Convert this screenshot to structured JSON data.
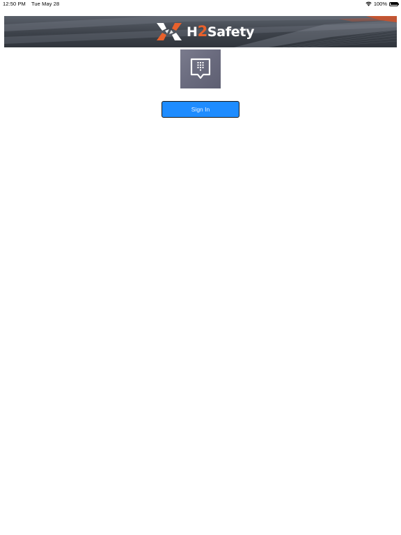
{
  "status_bar": {
    "time": "12:50 PM",
    "date": "Tue May 28",
    "battery_text": "100%",
    "battery_level": 1.0
  },
  "banner": {
    "brand_prefix": "H",
    "brand_number": "2",
    "brand_suffix": "Safety",
    "accent_color": "#e8612c"
  },
  "app_icon": {
    "icon": "chat-keypad-icon"
  },
  "signin": {
    "label": "Sign In",
    "color": "#1e8cff"
  }
}
